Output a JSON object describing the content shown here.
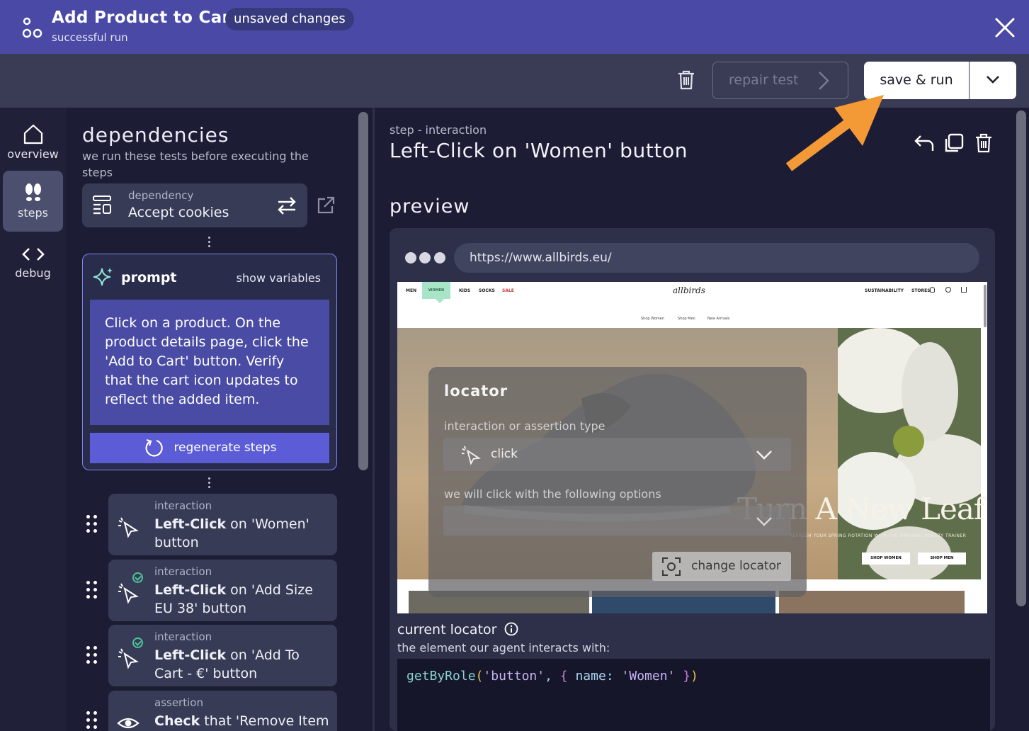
{
  "header": {
    "title": "Add Product to Cart",
    "badge": "unsaved changes",
    "subtitle": "successful run"
  },
  "toolbar": {
    "repair_label": "repair test",
    "save_label": "save & run"
  },
  "nav": {
    "overview": "overview",
    "steps": "steps",
    "debug": "debug"
  },
  "dependencies": {
    "title": "dependencies",
    "subtitle": "we run these tests before executing the steps",
    "card_kind": "dependency",
    "card_name": "Accept cookies"
  },
  "prompt": {
    "label": "prompt",
    "show_variables": "show variables",
    "text": "Click on a product. On the product details page, click the 'Add to Cart' button. Verify that the cart icon updates to reflect the added item.",
    "regenerate": "regenerate steps"
  },
  "steps": [
    {
      "kind": "interaction",
      "action": "Left-Click",
      "rest": " on 'Women' button",
      "status": "none"
    },
    {
      "kind": "interaction",
      "action": "Left-Click",
      "rest": " on 'Add Size EU 38' button",
      "status": "success"
    },
    {
      "kind": "interaction",
      "action": "Left-Click",
      "rest": " on 'Add To Cart - €' button",
      "status": "success"
    },
    {
      "kind": "assertion",
      "action": "Check",
      "rest": " that 'Remove Item",
      "status": "none"
    }
  ],
  "detail": {
    "kind": "step - interaction",
    "title": "Left-Click on 'Women' button",
    "preview_label": "preview",
    "url": "https://www.allbirds.eu/"
  },
  "site": {
    "nav_left": [
      "MEN",
      "WOMEN",
      "KIDS",
      "SOCKS",
      "SALE"
    ],
    "logo": "allbirds",
    "nav_right": [
      "SUSTAINABILITY",
      "STORES"
    ],
    "sub_links": [
      "Shop Women",
      "Shop Men",
      "New Arrivals"
    ],
    "hero_title": "Turn A New Leaf",
    "hero_tagline": "REFRESH YOUR SPRING ROTATION WITH THE ORIGINAL BREEZY TRAINER",
    "btn_women": "SHOP WOMEN",
    "btn_men": "SHOP MEN"
  },
  "locator_panel": {
    "title": "locator",
    "type_label": "interaction or assertion type",
    "type_value": "click",
    "options_label": "we will click with the following options",
    "change_label": "change locator"
  },
  "current_locator": {
    "title": "current locator",
    "subtitle": "the element our agent interacts with:",
    "code_fn": "getByRole",
    "code_arg1": "'button'",
    "code_key": "name",
    "code_val": "'Women'"
  },
  "colors": {
    "header": "#4a4aa6",
    "toolbar": "#3a3c55",
    "accent": "#5b5cd6",
    "success": "#4cc49a",
    "arrow": "#f39a37"
  }
}
